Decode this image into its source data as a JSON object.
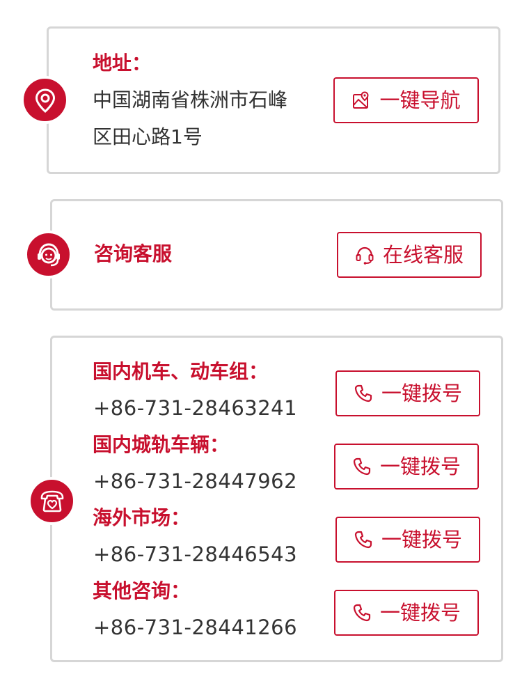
{
  "address": {
    "label": "地址：",
    "line1": "中国湖南省株洲市石峰",
    "line2": "区田心路1号",
    "button_label": "一键导航"
  },
  "service": {
    "label": "咨询客服",
    "button_label": "在线客服"
  },
  "contacts": [
    {
      "label": "国内机车、动车组：",
      "phone": "+86-731-28463241",
      "button_label": "一键拨号"
    },
    {
      "label": "国内城轨车辆：",
      "phone": "+86-731-28447962",
      "button_label": "一键拨号"
    },
    {
      "label": "海外市场：",
      "phone": "+86-731-28446543",
      "button_label": "一键拨号"
    },
    {
      "label": "其他咨询：",
      "phone": "+86-731-28441266",
      "button_label": "一键拨号"
    }
  ],
  "icons": {
    "address_badge": "location-pin-icon",
    "service_badge": "customer-service-icon",
    "phone_badge": "telephone-icon",
    "nav_button": "map-icon",
    "service_button": "headset-icon",
    "dial_button": "phone-handset-icon"
  },
  "colors": {
    "accent": "#c8102e",
    "text": "#333333",
    "border": "#d6d6d6"
  }
}
